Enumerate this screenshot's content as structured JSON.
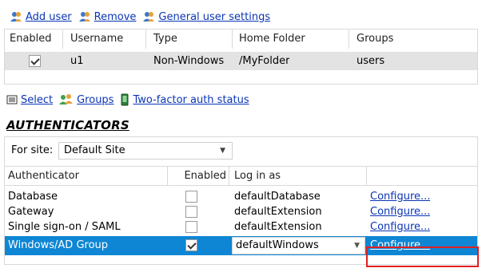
{
  "users_toolbar": {
    "add_user": "Add user",
    "remove": "Remove",
    "general_settings": "General user settings"
  },
  "users_table": {
    "columns": [
      "Enabled",
      "Username",
      "Type",
      "Home Folder",
      "Groups"
    ],
    "rows": [
      {
        "enabled": true,
        "username": "u1",
        "type": "Non-Windows",
        "home_folder": "/MyFolder",
        "groups": "users"
      }
    ]
  },
  "selection_toolbar": {
    "select": "Select",
    "groups": "Groups",
    "two_factor": "Two-factor auth status"
  },
  "authenticators": {
    "title": "AUTHENTICATORS",
    "site_label": "For site:",
    "site_value": "Default Site",
    "columns": [
      "Authenticator",
      "Enabled",
      "Log in as"
    ],
    "rows": [
      {
        "name": "Database",
        "enabled": false,
        "login_as": "defaultDatabase",
        "action": "Configure..."
      },
      {
        "name": "Gateway",
        "enabled": false,
        "login_as": "defaultExtension",
        "action": "Configure..."
      },
      {
        "name": "Single sign-on / SAML",
        "enabled": false,
        "login_as": "defaultExtension",
        "action": "Configure..."
      },
      {
        "name": "Windows/AD Group",
        "enabled": true,
        "login_as": "defaultWindows",
        "action": "Configure...",
        "selected": true
      }
    ]
  },
  "colors": {
    "link": "#0a35b5",
    "selection": "#0e86d4",
    "highlight": "#e02020",
    "row_selected_gray": "#e3e3e3"
  }
}
